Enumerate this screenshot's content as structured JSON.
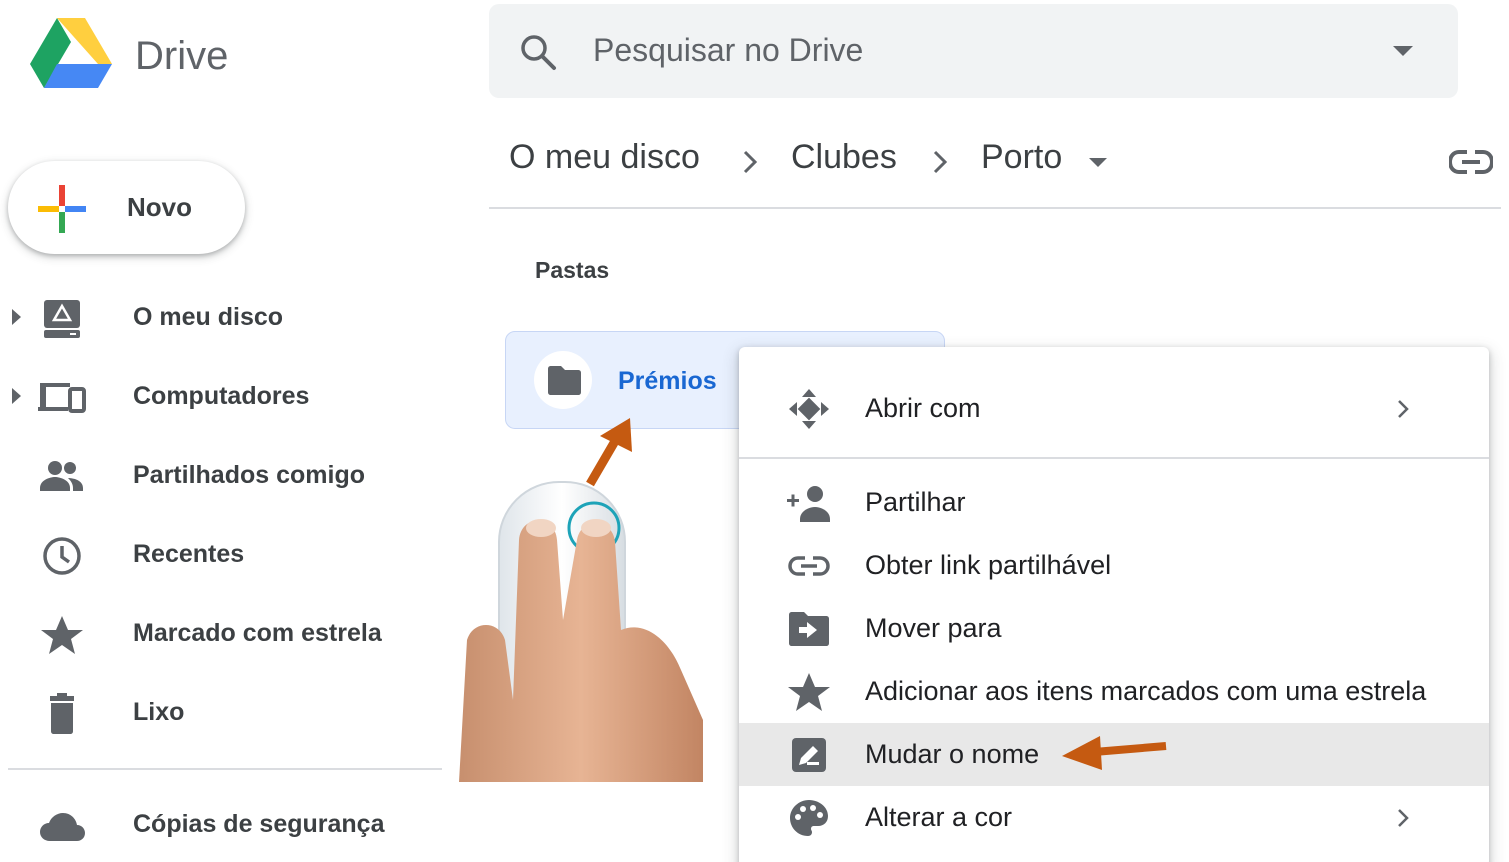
{
  "app": {
    "title": "Drive",
    "logo_icon": "google-drive-logo"
  },
  "search": {
    "placeholder": "Pesquisar no Drive",
    "icon": "search-icon",
    "options_icon": "arrow-drop-down-icon"
  },
  "new_button": {
    "label": "Novo",
    "icon": "plus-icon"
  },
  "sidebar": {
    "items": [
      {
        "label": "O meu disco",
        "icon": "my-drive-icon",
        "expandable": true
      },
      {
        "label": "Computadores",
        "icon": "computers-icon",
        "expandable": true
      },
      {
        "label": "Partilhados comigo",
        "icon": "people-icon",
        "expandable": false
      },
      {
        "label": "Recentes",
        "icon": "clock-icon",
        "expandable": false
      },
      {
        "label": "Marcado com estrela",
        "icon": "star-icon",
        "expandable": false
      },
      {
        "label": "Lixo",
        "icon": "trash-icon",
        "expandable": false
      }
    ],
    "storage": {
      "label": "Cópias de segurança",
      "icon": "cloud-icon"
    }
  },
  "breadcrumb": {
    "items": [
      "O meu disco",
      "Clubes",
      "Porto"
    ],
    "link_icon": "link-icon"
  },
  "content": {
    "section_label": "Pastas",
    "folders": [
      {
        "name": "Prémios",
        "icon": "folder-icon",
        "selected": true
      }
    ]
  },
  "context_menu": {
    "items": [
      {
        "label": "Abrir com",
        "icon": "move-arrows-icon",
        "submenu": true
      },
      {
        "label": "Partilhar",
        "icon": "add-person-icon",
        "submenu": false
      },
      {
        "label": "Obter link partilhável",
        "icon": "link-icon",
        "submenu": false
      },
      {
        "label": "Mover para",
        "icon": "move-to-folder-icon",
        "submenu": false
      },
      {
        "label": "Adicionar aos itens marcados com uma estrela",
        "icon": "star-icon",
        "submenu": false
      },
      {
        "label": "Mudar o nome",
        "icon": "rename-icon",
        "submenu": false,
        "highlighted": true
      },
      {
        "label": "Alterar a cor",
        "icon": "palette-icon",
        "submenu": true
      }
    ]
  },
  "overlay": {
    "hand_illustration": "right-click-mouse-hand",
    "arrow_color": "#c55a11"
  },
  "colors": {
    "accent": "#1967d2",
    "selected_bg": "#e8f0fe",
    "search_bg": "#f1f3f4",
    "menu_highlight": "#e8e8e8"
  }
}
